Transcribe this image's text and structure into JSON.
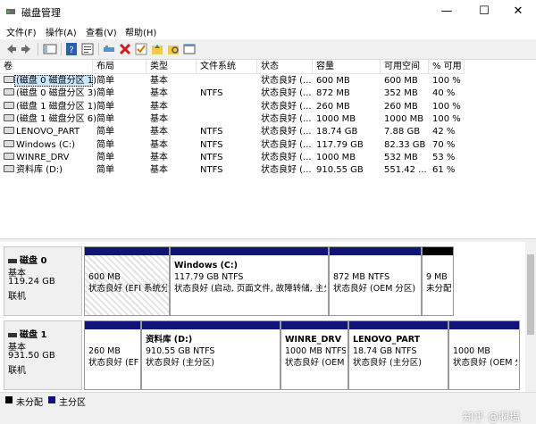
{
  "window": {
    "title": "磁盘管理",
    "minimize": "—",
    "maximize": "☐",
    "close": "✕"
  },
  "menu": [
    "文件(F)",
    "操作(A)",
    "查看(V)",
    "帮助(H)"
  ],
  "toolbar_icons": [
    "back-icon",
    "forward-icon",
    "console-icon",
    "help-icon",
    "properties-icon",
    "connect-icon",
    "delete-icon",
    "check-icon",
    "folder-up-icon",
    "folder-search-icon",
    "window-icon"
  ],
  "volume_table": {
    "headers": [
      "卷",
      "布局",
      "类型",
      "文件系统",
      "状态",
      "容量",
      "可用空间",
      "% 可用"
    ],
    "rows": [
      {
        "vol": "(磁盘 0 磁盘分区 1)",
        "layout": "简单",
        "type": "基本",
        "fs": "",
        "status": "状态良好 (...",
        "cap": "600 MB",
        "free": "600 MB",
        "pct": "100 %"
      },
      {
        "vol": "(磁盘 0 磁盘分区 3)",
        "layout": "简单",
        "type": "基本",
        "fs": "NTFS",
        "status": "状态良好 (...",
        "cap": "872 MB",
        "free": "352 MB",
        "pct": "40 %"
      },
      {
        "vol": "(磁盘 1 磁盘分区 1)",
        "layout": "简单",
        "type": "基本",
        "fs": "",
        "status": "状态良好 (...",
        "cap": "260 MB",
        "free": "260 MB",
        "pct": "100 %"
      },
      {
        "vol": "(磁盘 1 磁盘分区 6)",
        "layout": "简单",
        "type": "基本",
        "fs": "",
        "status": "状态良好 (...",
        "cap": "1000 MB",
        "free": "1000 MB",
        "pct": "100 %"
      },
      {
        "vol": "LENOVO_PART",
        "layout": "简单",
        "type": "基本",
        "fs": "NTFS",
        "status": "状态良好 (...",
        "cap": "18.74 GB",
        "free": "7.88 GB",
        "pct": "42 %"
      },
      {
        "vol": "Windows (C:)",
        "layout": "简单",
        "type": "基本",
        "fs": "NTFS",
        "status": "状态良好 (...",
        "cap": "117.79 GB",
        "free": "82.33 GB",
        "pct": "70 %"
      },
      {
        "vol": "WINRE_DRV",
        "layout": "简单",
        "type": "基本",
        "fs": "NTFS",
        "status": "状态良好 (...",
        "cap": "1000 MB",
        "free": "532 MB",
        "pct": "53 %"
      },
      {
        "vol": "资料库 (D:)",
        "layout": "简单",
        "type": "基本",
        "fs": "NTFS",
        "status": "状态良好 (...",
        "cap": "910.55 GB",
        "free": "551.42 ...",
        "pct": "61 %"
      }
    ]
  },
  "disks": [
    {
      "name": "磁盘 0",
      "type": "基本",
      "size": "119.24 GB",
      "state": "联机",
      "partitions": [
        {
          "title": "",
          "line1": "600 MB",
          "line2": "状态良好 (EFI 系统分区)",
          "bar": "#101478",
          "hatched": true
        },
        {
          "title": "Windows  (C:)",
          "line1": "117.79 GB NTFS",
          "line2": "状态良好 (启动, 页面文件, 故障转储, 主分区)",
          "bar": "#101478",
          "hatched": false
        },
        {
          "title": "",
          "line1": "872 MB NTFS",
          "line2": "状态良好 (OEM 分区)",
          "bar": "#101478",
          "hatched": false
        },
        {
          "title": "",
          "line1": "9 MB",
          "line2": "未分配",
          "bar": "#000000",
          "hatched": false
        }
      ]
    },
    {
      "name": "磁盘 1",
      "type": "基本",
      "size": "931.50 GB",
      "state": "联机",
      "partitions": [
        {
          "title": "",
          "line1": "260 MB",
          "line2": "状态良好 (EFI 系统分区)",
          "bar": "#101478",
          "hatched": false
        },
        {
          "title": "资料库  (D:)",
          "line1": "910.55 GB NTFS",
          "line2": "状态良好 (主分区)",
          "bar": "#101478",
          "hatched": false
        },
        {
          "title": "WINRE_DRV",
          "line1": "1000 MB NTFS",
          "line2": "状态良好 (OEM 分区)",
          "bar": "#101478",
          "hatched": false
        },
        {
          "title": "LENOVO_PART",
          "line1": "18.74 GB NTFS",
          "line2": "状态良好 (主分区)",
          "bar": "#101478",
          "hatched": false
        },
        {
          "title": "",
          "line1": "1000 MB",
          "line2": "状态良好 (OEM 分区)",
          "bar": "#101478",
          "hatched": false
        }
      ]
    }
  ],
  "legend": [
    {
      "label": "未分配",
      "color": "#000000"
    },
    {
      "label": "主分区",
      "color": "#101478"
    }
  ],
  "watermark": "知乎 @啊瑥"
}
